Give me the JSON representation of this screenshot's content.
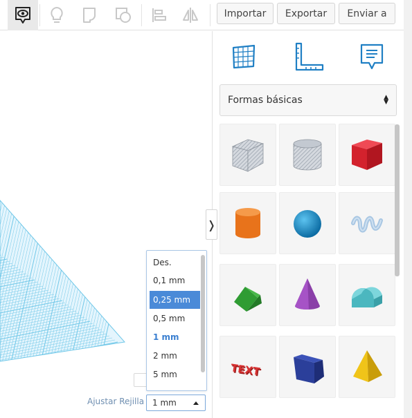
{
  "toolbar": {
    "tools": [
      {
        "name": "view-icon",
        "active": true
      },
      {
        "name": "lightbulb-icon",
        "active": false
      },
      {
        "name": "note-icon",
        "active": false
      },
      {
        "name": "shapes-icon",
        "active": false
      },
      {
        "name": "align-icon",
        "active": false
      },
      {
        "name": "mirror-icon",
        "active": false
      }
    ],
    "import_label": "Importar",
    "export_label": "Exportar",
    "send_label": "Enviar a"
  },
  "snap_grid": {
    "label": "Ajustar Rejilla",
    "selected": "1 mm",
    "options": [
      "Des.",
      "0,1 mm",
      "0,25 mm",
      "0,5 mm",
      "1 mm",
      "2 mm",
      "5 mm"
    ],
    "highlighted_option": "0,25 mm"
  },
  "panel": {
    "tabs": [
      "grid-icon",
      "ruler-icon",
      "notes-icon"
    ],
    "library_select": "Formas básicas",
    "collapse_glyph": "❭",
    "shapes": [
      {
        "name": "box-hole-shape",
        "color": "#b5bcc6"
      },
      {
        "name": "cylinder-hole-shape",
        "color": "#b5bcc6"
      },
      {
        "name": "box-shape",
        "color": "#d9252f"
      },
      {
        "name": "cylinder-shape",
        "color": "#e8731b"
      },
      {
        "name": "sphere-shape",
        "color": "#1a8fcf"
      },
      {
        "name": "scribble-shape",
        "color": "#a9c7e3"
      },
      {
        "name": "roof-shape",
        "color": "#3aa83a"
      },
      {
        "name": "cone-shape",
        "color": "#8a3fa8"
      },
      {
        "name": "round-roof-shape",
        "color": "#5ec5cc"
      },
      {
        "name": "text-shape",
        "color": "#cc2a2a"
      },
      {
        "name": "wedge-shape",
        "color": "#2b3f9a"
      },
      {
        "name": "pyramid-shape",
        "color": "#f0c419"
      }
    ]
  },
  "colors": {
    "accent": "#1f7fc4",
    "grid": "#6fc7e8",
    "highlight": "#4a8ad8"
  }
}
